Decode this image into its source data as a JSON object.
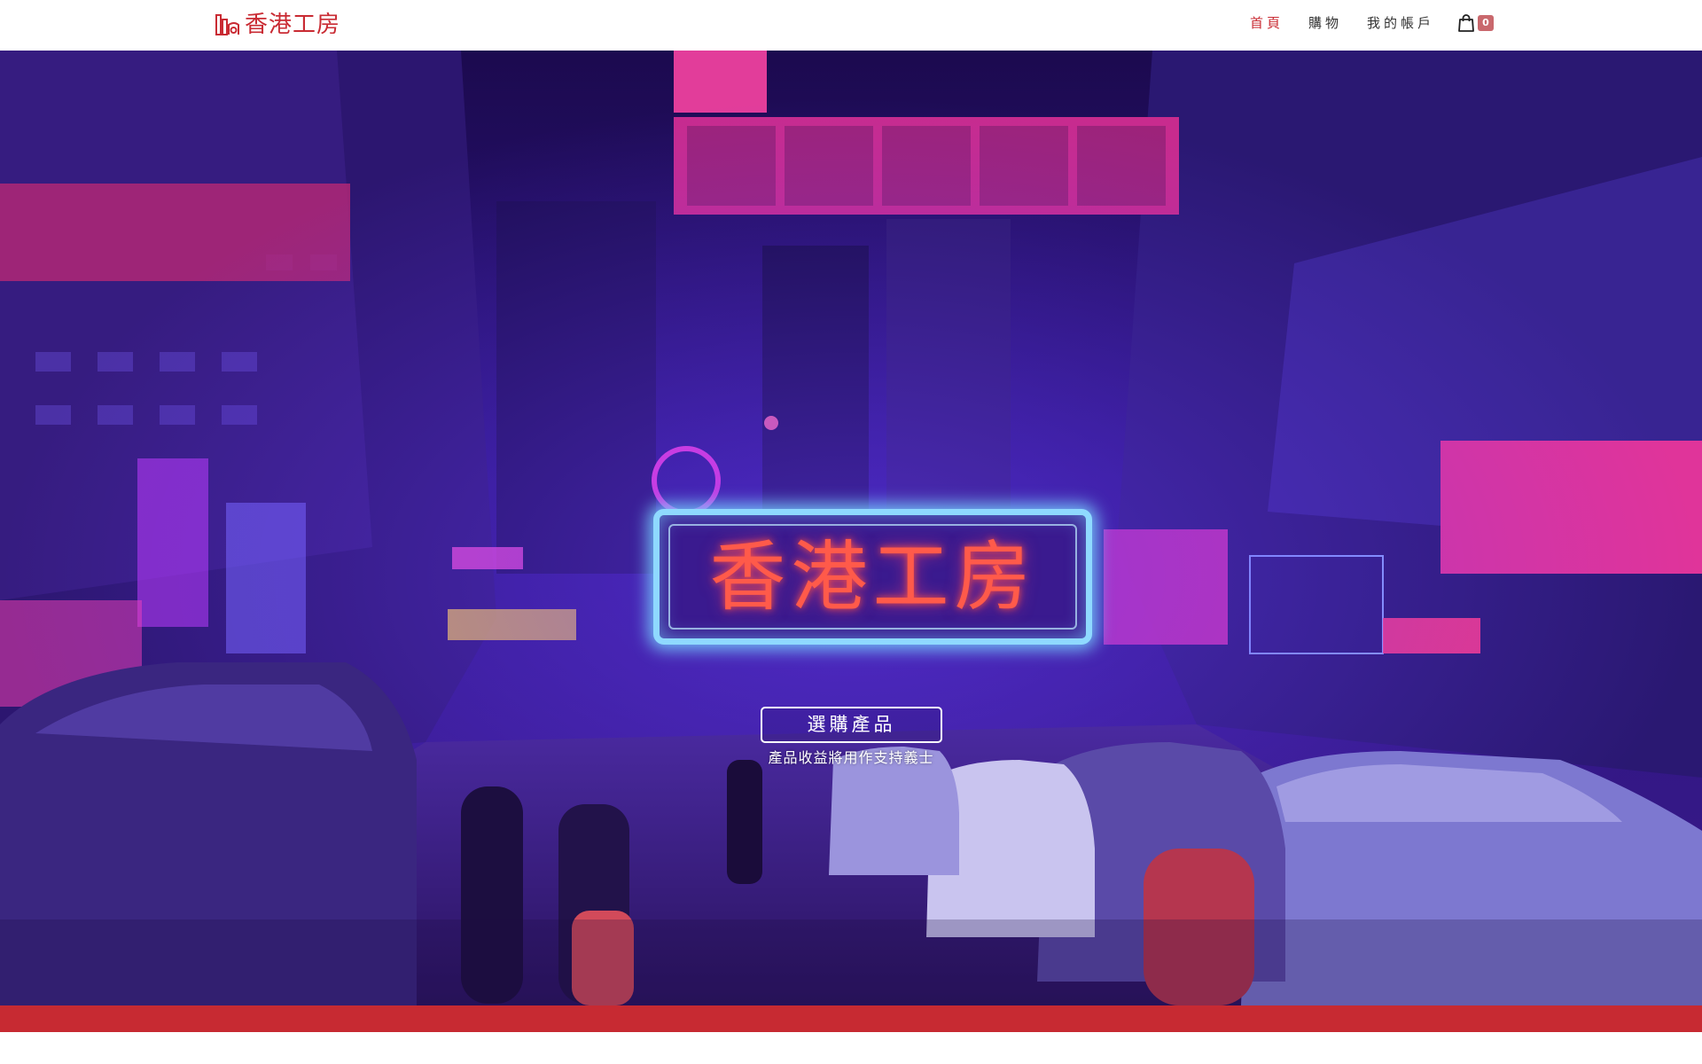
{
  "header": {
    "logo_text": "香港工房",
    "nav": [
      {
        "label": "首頁",
        "active": true
      },
      {
        "label": "購物",
        "active": false
      },
      {
        "label": "我的帳戶",
        "active": false
      }
    ],
    "cart_count": "0"
  },
  "hero": {
    "sign_text": "香港工房",
    "cta_label": "選購產品",
    "cta_subtext": "產品收益將用作支持義士"
  },
  "colors": {
    "brand_red": "#c92b33",
    "hero_purple": "#2a0f6b",
    "neon_blue": "#8fd9ff",
    "neon_orange": "#ff5a4a"
  }
}
